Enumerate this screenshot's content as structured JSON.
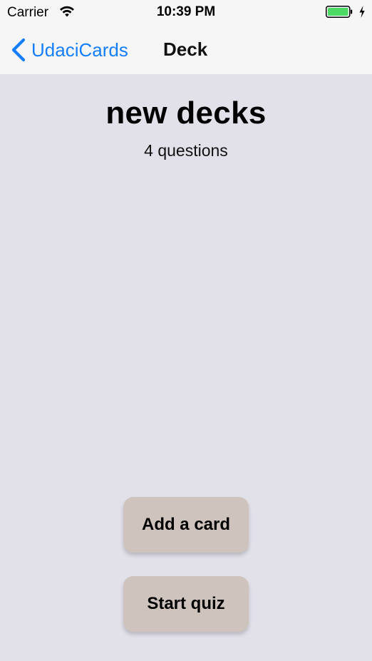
{
  "status_bar": {
    "carrier": "Carrier",
    "time": "10:39 PM",
    "wifi_icon": "wifi-icon",
    "battery_icon": "battery-icon",
    "battery_color": "#4cd964"
  },
  "nav": {
    "back_label": "UdaciCards",
    "title": "Deck",
    "accent": "#147efb"
  },
  "deck": {
    "title": "new decks",
    "count_text": "4 questions"
  },
  "actions": {
    "add_card_label": "Add a card",
    "start_quiz_label": "Start quiz",
    "button_color": "#cfc4bd"
  }
}
